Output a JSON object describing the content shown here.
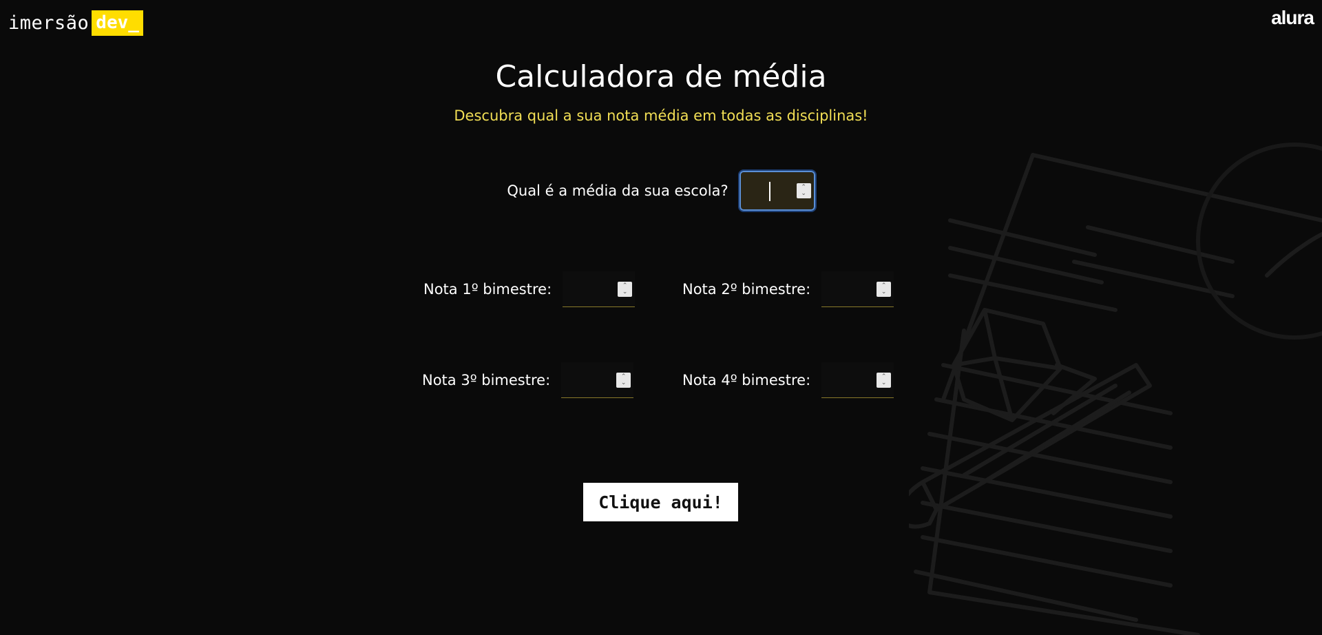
{
  "header": {
    "logo_text": "imersão",
    "logo_badge": "dev_",
    "brand": "alura"
  },
  "main": {
    "title": "Calculadora de média",
    "subtitle": "Descubra qual a sua nota média em todas as disciplinas!",
    "school_average": {
      "label": "Qual é a média da sua escola?",
      "value": ""
    },
    "grades": [
      {
        "label": "Nota 1º bimestre:",
        "value": ""
      },
      {
        "label": "Nota 2º bimestre:",
        "value": ""
      },
      {
        "label": "Nota 3º bimestre:",
        "value": ""
      },
      {
        "label": "Nota 4º bimestre:",
        "value": ""
      }
    ],
    "button_label": "Clique aqui!"
  },
  "colors": {
    "background": "#0a0a0a",
    "accent_yellow": "#ffdd00",
    "subtitle_yellow": "#f2df55",
    "focus_blue": "#5b8fd6"
  },
  "icons": {
    "spinner": "spin-arrows-icon",
    "background": "notebook-pencil-illustration"
  }
}
